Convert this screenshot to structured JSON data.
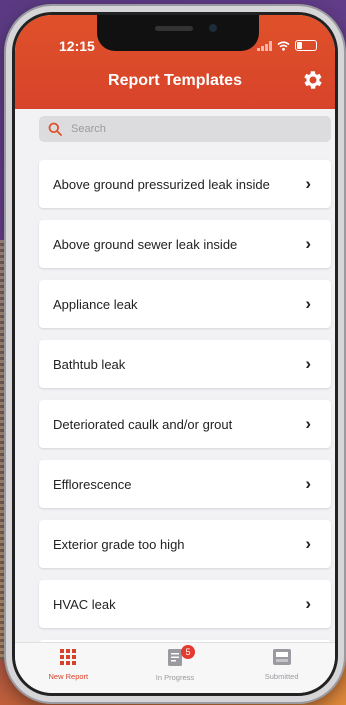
{
  "status_bar": {
    "time": "12:15"
  },
  "header": {
    "title": "Report Templates"
  },
  "search": {
    "placeholder": "Search"
  },
  "templates": [
    "Above ground pressurized leak inside",
    "Above ground sewer leak inside",
    "Appliance leak",
    "Bathtub leak",
    "Deteriorated caulk and/or grout",
    "Efflorescence",
    "Exterior grade too high",
    "HVAC leak"
  ],
  "tabs": {
    "new_report": "New Report",
    "in_progress": "In Progress",
    "submitted": "Submitted",
    "in_progress_badge": "5"
  },
  "colors": {
    "header": "#d7432a",
    "accent": "#e0512a",
    "badge": "#e53a2f"
  },
  "icons": [
    "settings-gear-icon",
    "search-icon",
    "chevron-right-icon",
    "grid-icon",
    "document-icon",
    "inbox-tray-icon"
  ]
}
